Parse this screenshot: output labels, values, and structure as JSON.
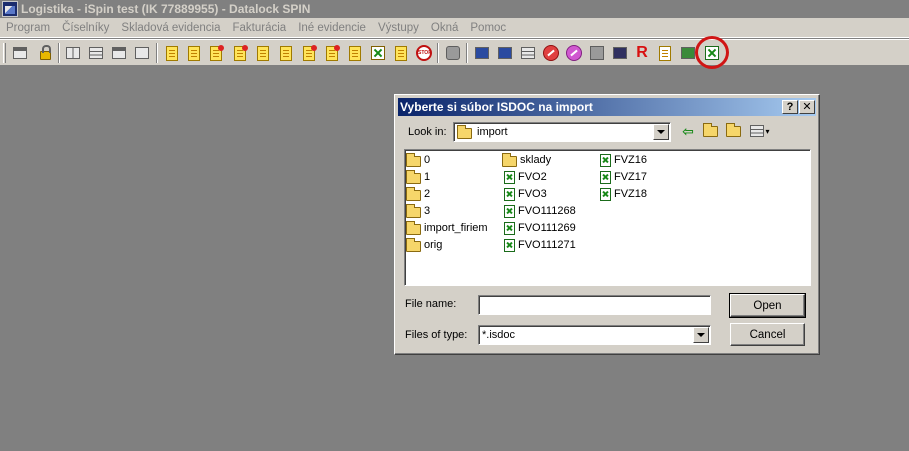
{
  "window": {
    "title": "Logistika - iSpin test (IK 77889955) - Datalock SPIN"
  },
  "menu": [
    "Program",
    "Číselníky",
    "Skladová evidencia",
    "Fakturácia",
    "Iné evidencie",
    "Výstupy",
    "Okná",
    "Pomoc"
  ],
  "toolbar": {
    "highlight_color": "#d01515",
    "r_label": "R"
  },
  "dialog": {
    "title": "Vyberte si súbor ISDOC na import",
    "help_label": "?",
    "close_label": "✕",
    "look_in_label": "Look in:",
    "look_in_value": "import",
    "file_name_label": "File name:",
    "file_name_value": "",
    "files_of_type_label": "Files of type:",
    "files_of_type_value": "*.isdoc",
    "open_label": "Open",
    "cancel_label": "Cancel",
    "columns": [
      [
        {
          "name": "0",
          "type": "folder"
        },
        {
          "name": "1",
          "type": "folder"
        },
        {
          "name": "2",
          "type": "folder"
        },
        {
          "name": "3",
          "type": "folder"
        },
        {
          "name": "import_firiem",
          "type": "folder"
        },
        {
          "name": "orig",
          "type": "folder"
        }
      ],
      [
        {
          "name": "sklady",
          "type": "folder"
        },
        {
          "name": "FVO2",
          "type": "file"
        },
        {
          "name": "FVO3",
          "type": "file"
        },
        {
          "name": "FVO111268",
          "type": "file"
        },
        {
          "name": "FVO111269",
          "type": "file"
        },
        {
          "name": "FVO111271",
          "type": "file"
        }
      ],
      [
        {
          "name": "FVZ16",
          "type": "file"
        },
        {
          "name": "FVZ17",
          "type": "file"
        },
        {
          "name": "FVZ18",
          "type": "file"
        }
      ]
    ]
  }
}
